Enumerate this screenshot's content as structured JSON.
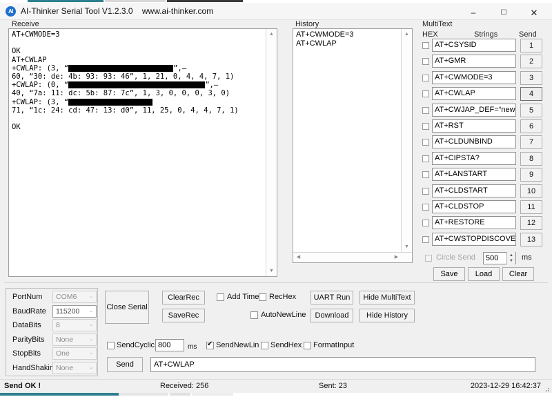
{
  "window": {
    "title": "AI-Thinker Serial Tool V1.2.3.0    www.ai-thinker.com",
    "icon_label": "AI",
    "minimize": "–",
    "maximize": "☐",
    "close": "✕"
  },
  "receive": {
    "group_label": "Receive",
    "lines": [
      {
        "text": "AT+CWMODE=3"
      },
      {
        "text": ""
      },
      {
        "text": "OK"
      },
      {
        "text": "AT+CWLAP"
      },
      {
        "pre": "+CWLAP: (3, “",
        "redact": 152,
        "post": "”,–"
      },
      {
        "text": "60, “30: de: 4b: 93: 93: 46”, 1, 21, 0, 4, 4, 7, 1)"
      },
      {
        "pre": "+CWLAP: (0, “",
        "redact": 198,
        "post": "”,–"
      },
      {
        "text": "40, “7a: 11: dc: 5b: 87: 7c”, 1, 3, 0, 0, 0, 3, 0)"
      },
      {
        "pre": "+CWLAP: (3, “",
        "redact": 122,
        "post": ""
      },
      {
        "text": "71, “1c: 24: cd: 47: 13: d0”, 11, 25, 0, 4, 4, 7, 1)"
      },
      {
        "text": ""
      },
      {
        "text": "OK"
      }
    ],
    "scroll_up": "▲",
    "scroll_down": "▼"
  },
  "history": {
    "group_label": "History",
    "entries": [
      "AT+CWMODE=3",
      "AT+CWLAP"
    ],
    "scroll_up": "▲",
    "scroll_down": "▼",
    "scroll_left": "◀",
    "scroll_right": "▶"
  },
  "multitext": {
    "group_label": "MultiText",
    "col_hex": "HEX",
    "col_strings": "Strings",
    "col_send": "Send",
    "rows": [
      {
        "command": "AT+CSYSID",
        "send": "1",
        "selected": false
      },
      {
        "command": "AT+GMR",
        "send": "2",
        "selected": false
      },
      {
        "command": "AT+CWMODE=3",
        "send": "3",
        "selected": false
      },
      {
        "command": "AT+CWLAP",
        "send": "4",
        "selected": true
      },
      {
        "command": "AT+CWJAP_DEF=“newifi_",
        "send": "5",
        "selected": false
      },
      {
        "command": "AT+RST",
        "send": "6",
        "selected": false
      },
      {
        "command": "AT+CLDUNBIND",
        "send": "7",
        "selected": false
      },
      {
        "command": "AT+CIPSTA?",
        "send": "8",
        "selected": false
      },
      {
        "command": "AT+LANSTART",
        "send": "9",
        "selected": false
      },
      {
        "command": "AT+CLDSTART",
        "send": "10",
        "selected": false
      },
      {
        "command": "AT+CLDSTOP",
        "send": "11",
        "selected": false
      },
      {
        "command": "AT+RESTORE",
        "send": "12",
        "selected": false
      },
      {
        "command": "AT+CWSTOPDISCOVER",
        "send": "13",
        "selected": false
      }
    ],
    "circle_send_label": "Circle Send",
    "circle_send_ms": "500",
    "ms_unit": "ms",
    "spin_up": "▲",
    "spin_down": "▼",
    "save_label": "Save",
    "load_label": "Load",
    "clear_label": "Clear"
  },
  "settings": {
    "rows": [
      {
        "label": "PortNum",
        "value": "COM6",
        "active": false
      },
      {
        "label": "BaudRate",
        "value": "115200",
        "active": true
      },
      {
        "label": "DataBits",
        "value": "8",
        "active": false
      },
      {
        "label": "ParityBits",
        "value": "None",
        "active": false
      },
      {
        "label": "StopBits",
        "value": "One",
        "active": false
      },
      {
        "label": "HandShaking",
        "value": "None",
        "active": false
      }
    ],
    "chevron": "⌄"
  },
  "controls": {
    "close_serial": "Close Serial",
    "clear_rec": "ClearRec",
    "save_rec": "SaveRec",
    "add_time": "Add Time",
    "rec_hex": "RecHex",
    "auto_newline": "AutoNewLine",
    "uart_run": "UART Run",
    "download": "Download",
    "hide_multitext": "Hide MultiText",
    "hide_history": "Hide History"
  },
  "send_area": {
    "send_cyclic_label": "SendCyclic",
    "cycle_ms": "800",
    "ms_unit": "ms",
    "send_newline_label": "SendNewLin",
    "send_hex_label": "SendHex",
    "format_input_label": "FormatInput",
    "send_button": "Send",
    "send_text": "AT+CWLAP"
  },
  "status": {
    "message": "Send OK !",
    "received": "Received: 256",
    "sent": "Sent: 23",
    "timestamp": "2023-12-29 16:42:37"
  },
  "colors": {
    "accent_teal": "#2f7f8f",
    "icon_blue": "#1f6fd0",
    "panel_bg": "#f0f0f0"
  }
}
